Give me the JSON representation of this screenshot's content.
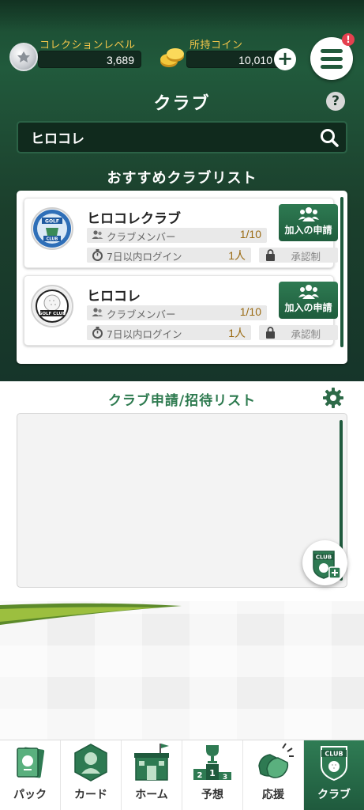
{
  "header": {
    "collection_level_label": "コレクションレベル",
    "collection_level_value": "3,689",
    "coins_label": "所持コイン",
    "coins_value": "10,010",
    "notification_badge": "!",
    "page_title": "クラブ",
    "help_label": "?"
  },
  "search": {
    "value": "ヒロコレ",
    "icon": "search-icon"
  },
  "recommended": {
    "title": "おすすめクラブリスト",
    "clubs": [
      {
        "name": "ヒロコレクラブ",
        "members_label": "クラブメンバー",
        "members_value": "1/10",
        "login_label": "7日以内ログイン",
        "login_value": "1人",
        "approval_label": "承認制",
        "join_label": "加入の申請",
        "emblem": "golf-club-blue-emblem"
      },
      {
        "name": "ヒロコレ",
        "members_label": "クラブメンバー",
        "members_value": "1/10",
        "login_label": "7日以内ログイン",
        "login_value": "1人",
        "approval_label": "承認制",
        "join_label": "加入の申請",
        "emblem": "golf-club-ball-emblem"
      }
    ]
  },
  "applications": {
    "title": "クラブ申請/招待リスト"
  },
  "nav": [
    {
      "label": "パック",
      "icon": "pack-icon"
    },
    {
      "label": "カード",
      "icon": "card-icon"
    },
    {
      "label": "ホーム",
      "icon": "home-icon"
    },
    {
      "label": "予想",
      "icon": "prediction-icon"
    },
    {
      "label": "応援",
      "icon": "cheer-icon"
    },
    {
      "label": "クラブ",
      "icon": "club-icon",
      "active": true
    }
  ],
  "colors": {
    "primary_green": "#1f5a3d",
    "accent_gold": "#f1c54a",
    "value_brown": "#9a6a12",
    "badge_red": "#e5404f"
  }
}
